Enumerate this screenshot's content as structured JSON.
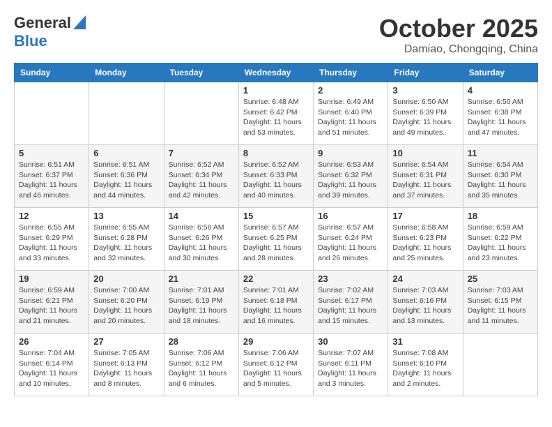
{
  "logo": {
    "line1": "General",
    "line2": "Blue"
  },
  "title": "October 2025",
  "subtitle": "Damiao, Chongqing, China",
  "weekdays": [
    "Sunday",
    "Monday",
    "Tuesday",
    "Wednesday",
    "Thursday",
    "Friday",
    "Saturday"
  ],
  "weeks": [
    [
      {
        "day": "",
        "info": ""
      },
      {
        "day": "",
        "info": ""
      },
      {
        "day": "",
        "info": ""
      },
      {
        "day": "1",
        "info": "Sunrise: 6:48 AM\nSunset: 6:42 PM\nDaylight: 11 hours\nand 53 minutes."
      },
      {
        "day": "2",
        "info": "Sunrise: 6:49 AM\nSunset: 6:40 PM\nDaylight: 11 hours\nand 51 minutes."
      },
      {
        "day": "3",
        "info": "Sunrise: 6:50 AM\nSunset: 6:39 PM\nDaylight: 11 hours\nand 49 minutes."
      },
      {
        "day": "4",
        "info": "Sunrise: 6:50 AM\nSunset: 6:38 PM\nDaylight: 11 hours\nand 47 minutes."
      }
    ],
    [
      {
        "day": "5",
        "info": "Sunrise: 6:51 AM\nSunset: 6:37 PM\nDaylight: 11 hours\nand 46 minutes."
      },
      {
        "day": "6",
        "info": "Sunrise: 6:51 AM\nSunset: 6:36 PM\nDaylight: 11 hours\nand 44 minutes."
      },
      {
        "day": "7",
        "info": "Sunrise: 6:52 AM\nSunset: 6:34 PM\nDaylight: 11 hours\nand 42 minutes."
      },
      {
        "day": "8",
        "info": "Sunrise: 6:52 AM\nSunset: 6:33 PM\nDaylight: 11 hours\nand 40 minutes."
      },
      {
        "day": "9",
        "info": "Sunrise: 6:53 AM\nSunset: 6:32 PM\nDaylight: 11 hours\nand 39 minutes."
      },
      {
        "day": "10",
        "info": "Sunrise: 6:54 AM\nSunset: 6:31 PM\nDaylight: 11 hours\nand 37 minutes."
      },
      {
        "day": "11",
        "info": "Sunrise: 6:54 AM\nSunset: 6:30 PM\nDaylight: 11 hours\nand 35 minutes."
      }
    ],
    [
      {
        "day": "12",
        "info": "Sunrise: 6:55 AM\nSunset: 6:29 PM\nDaylight: 11 hours\nand 33 minutes."
      },
      {
        "day": "13",
        "info": "Sunrise: 6:55 AM\nSunset: 6:28 PM\nDaylight: 11 hours\nand 32 minutes."
      },
      {
        "day": "14",
        "info": "Sunrise: 6:56 AM\nSunset: 6:26 PM\nDaylight: 11 hours\nand 30 minutes."
      },
      {
        "day": "15",
        "info": "Sunrise: 6:57 AM\nSunset: 6:25 PM\nDaylight: 11 hours\nand 28 minutes."
      },
      {
        "day": "16",
        "info": "Sunrise: 6:57 AM\nSunset: 6:24 PM\nDaylight: 11 hours\nand 26 minutes."
      },
      {
        "day": "17",
        "info": "Sunrise: 6:58 AM\nSunset: 6:23 PM\nDaylight: 11 hours\nand 25 minutes."
      },
      {
        "day": "18",
        "info": "Sunrise: 6:59 AM\nSunset: 6:22 PM\nDaylight: 11 hours\nand 23 minutes."
      }
    ],
    [
      {
        "day": "19",
        "info": "Sunrise: 6:59 AM\nSunset: 6:21 PM\nDaylight: 11 hours\nand 21 minutes."
      },
      {
        "day": "20",
        "info": "Sunrise: 7:00 AM\nSunset: 6:20 PM\nDaylight: 11 hours\nand 20 minutes."
      },
      {
        "day": "21",
        "info": "Sunrise: 7:01 AM\nSunset: 6:19 PM\nDaylight: 11 hours\nand 18 minutes."
      },
      {
        "day": "22",
        "info": "Sunrise: 7:01 AM\nSunset: 6:18 PM\nDaylight: 11 hours\nand 16 minutes."
      },
      {
        "day": "23",
        "info": "Sunrise: 7:02 AM\nSunset: 6:17 PM\nDaylight: 11 hours\nand 15 minutes."
      },
      {
        "day": "24",
        "info": "Sunrise: 7:03 AM\nSunset: 6:16 PM\nDaylight: 11 hours\nand 13 minutes."
      },
      {
        "day": "25",
        "info": "Sunrise: 7:03 AM\nSunset: 6:15 PM\nDaylight: 11 hours\nand 11 minutes."
      }
    ],
    [
      {
        "day": "26",
        "info": "Sunrise: 7:04 AM\nSunset: 6:14 PM\nDaylight: 11 hours\nand 10 minutes."
      },
      {
        "day": "27",
        "info": "Sunrise: 7:05 AM\nSunset: 6:13 PM\nDaylight: 11 hours\nand 8 minutes."
      },
      {
        "day": "28",
        "info": "Sunrise: 7:06 AM\nSunset: 6:12 PM\nDaylight: 11 hours\nand 6 minutes."
      },
      {
        "day": "29",
        "info": "Sunrise: 7:06 AM\nSunset: 6:12 PM\nDaylight: 11 hours\nand 5 minutes."
      },
      {
        "day": "30",
        "info": "Sunrise: 7:07 AM\nSunset: 6:11 PM\nDaylight: 11 hours\nand 3 minutes."
      },
      {
        "day": "31",
        "info": "Sunrise: 7:08 AM\nSunset: 6:10 PM\nDaylight: 11 hours\nand 2 minutes."
      },
      {
        "day": "",
        "info": ""
      }
    ]
  ]
}
